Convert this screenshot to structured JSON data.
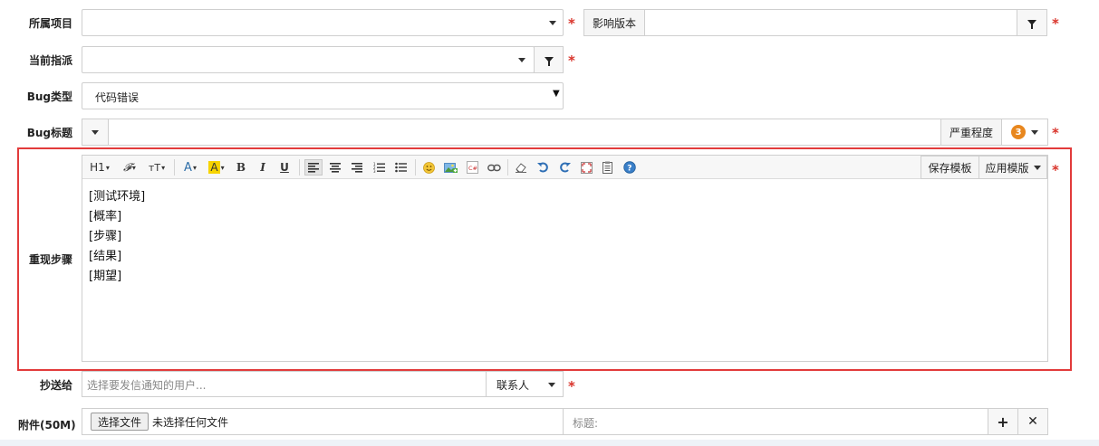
{
  "labels": {
    "project": "所属项目",
    "assign": "当前指派",
    "bug_type": "Bug类型",
    "bug_title": "Bug标题",
    "steps": "重现步骤",
    "cc": "抄送给",
    "attachment": "附件(50M)"
  },
  "fields": {
    "project_value": "",
    "affect_version_label": "影响版本",
    "affect_version_value": "",
    "assign_value": "",
    "bug_type_value": "代码错误",
    "bug_title_value": "",
    "severity_label": "严重程度",
    "severity_value": "3",
    "cc_placeholder": "选择要发信通知的用户...",
    "contact_label": "联系人",
    "file_button": "选择文件",
    "file_status": "未选择任何文件",
    "file_title_placeholder": "标题:"
  },
  "editor": {
    "toolbar": {
      "heading": "H1",
      "font": "𝓕",
      "size": "тT",
      "font_color": "A",
      "highlight": "A",
      "bold": "B",
      "italic": "I",
      "underline": "U",
      "save_template": "保存模板",
      "apply_template": "应用模版"
    },
    "lines": [
      "[测试环境]",
      "[概率]",
      "[步骤]",
      "[结果]",
      "[期望]"
    ]
  },
  "required_mark": "*",
  "colors": {
    "required": "#d9342b",
    "focus_outline": "#e23b3b",
    "severity_badge": "#e8871e"
  }
}
